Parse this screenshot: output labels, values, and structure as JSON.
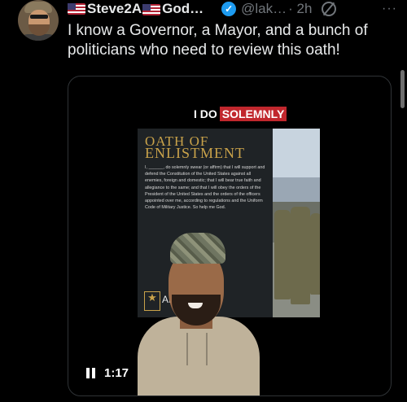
{
  "tweet": {
    "display_name": "Steve2A🇺🇸God…",
    "name_main": "Steve2A",
    "name_tail": "God…",
    "handle": "@lak…",
    "time": "· 2h",
    "more": "···",
    "text": "I know a Governor, a Mayor, and a bunch of politicians who need to review this oath!"
  },
  "video": {
    "caption_plain": "I DO",
    "caption_highlight": "SOLEMNLY",
    "poster_title_line1": "OATH OF",
    "poster_title_line2": "ENLISTMENT",
    "poster_body": "I, ______, do solemnly swear (or affirm) that I will support and defend the Constitution of the United States against all enemies, foreign and domestic; that I will bear true faith and allegiance to the same; and that I will obey the orders of the President of the United States and the orders of the officers appointed over me, according to regulations and the Uniform Code of Military Justice. So help me God.",
    "army_label": "ARM",
    "elapsed": "1:17"
  },
  "icons": [
    "flag-icon",
    "verified-badge-icon",
    "grok-icon",
    "more-icon",
    "pause-icon",
    "army-star-icon"
  ],
  "colors": {
    "accent_blue": "#1d9bf0",
    "muted": "#71767b",
    "caption_red": "#c1272d",
    "poster_gold": "#c9a24a"
  }
}
